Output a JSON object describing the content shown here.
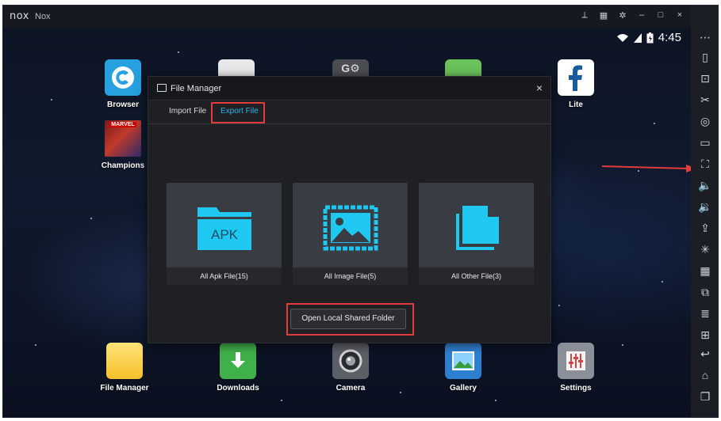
{
  "titlebar": {
    "logo": "nox",
    "title": "Nox",
    "controls": {
      "pin_icon": "pin-icon",
      "keyboard_icon": "keyboard-icon",
      "settings_icon": "gear-icon",
      "minimize": "–",
      "maximize": "□",
      "close": "×"
    }
  },
  "statusbar": {
    "time": "4:45"
  },
  "home_apps": {
    "top": [
      {
        "label": "Browser"
      },
      {
        "label": "Lite"
      }
    ],
    "left": [
      {
        "label": "Champions",
        "badge": "MARVEL"
      }
    ],
    "dock": [
      {
        "label": "File Manager"
      },
      {
        "label": "Downloads"
      },
      {
        "label": "Camera"
      },
      {
        "label": "Gallery"
      },
      {
        "label": "Settings"
      }
    ]
  },
  "dialog": {
    "title": "File Manager",
    "close": "×",
    "tabs": [
      {
        "label": "Import File",
        "active": false
      },
      {
        "label": "Export File",
        "active": true
      }
    ],
    "cards": [
      {
        "label": "All Apk File(15)",
        "icon_text": "APK"
      },
      {
        "label": "All Image File(5)"
      },
      {
        "label": "All Other File(3)"
      }
    ],
    "open_button": "Open Local Shared Folder"
  },
  "colors": {
    "accent": "#1ec8f0",
    "highlight": "#e23b3b",
    "tab_active": "#2fb6e8"
  }
}
